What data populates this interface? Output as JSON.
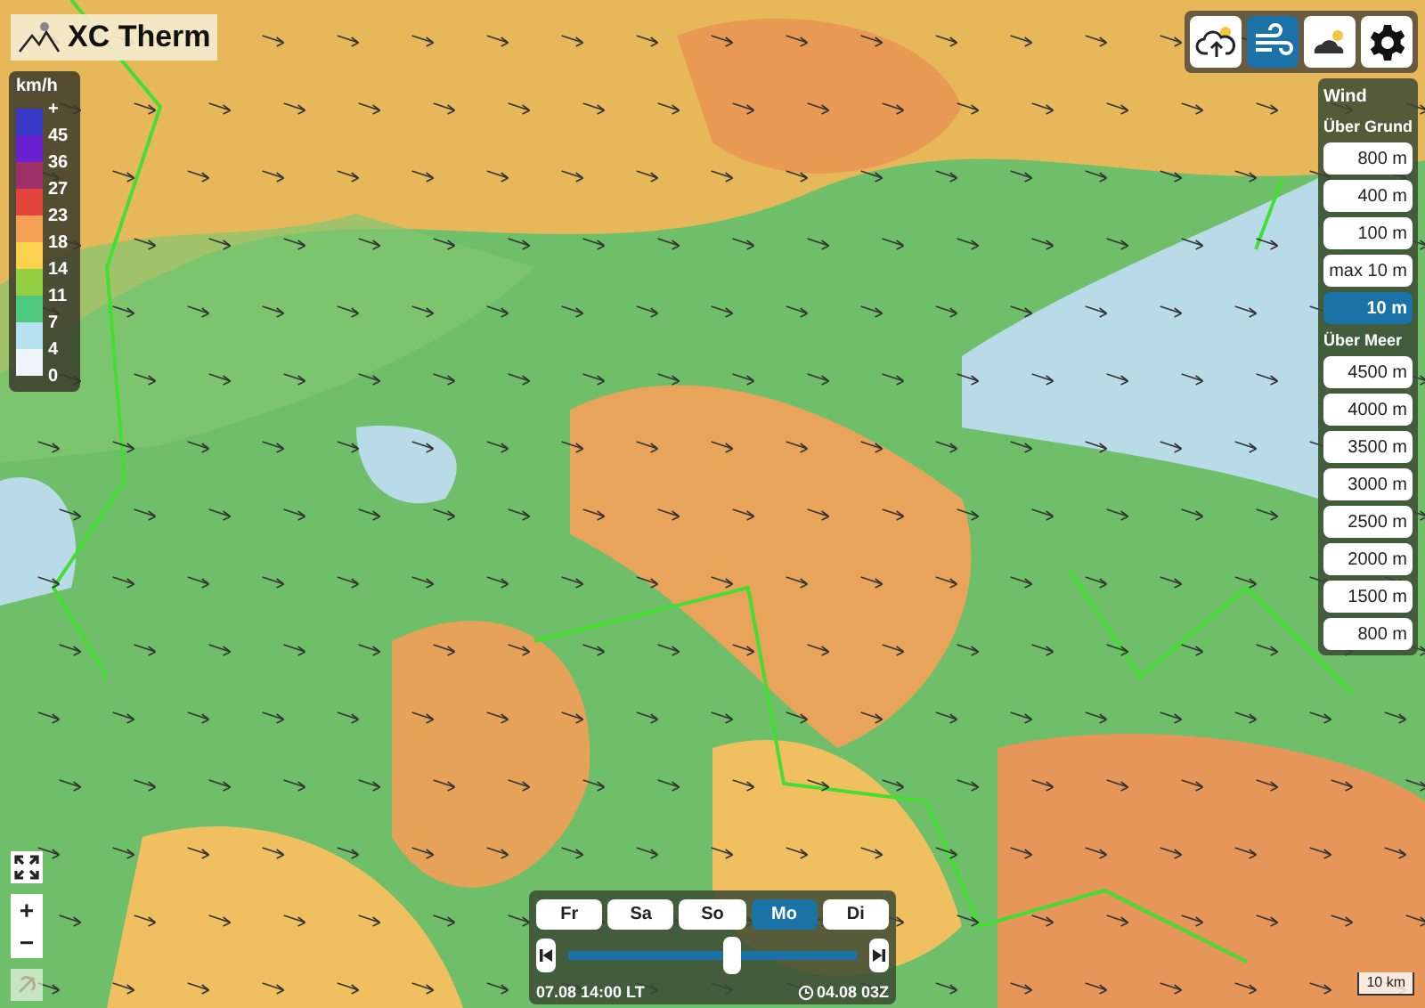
{
  "logo": {
    "title": "XC Therm"
  },
  "legend": {
    "unit": "km/h",
    "colors": [
      {
        "color": "#3a3ac8"
      },
      {
        "color": "#6a1fd0"
      },
      {
        "color": "#a0306a"
      },
      {
        "color": "#e2443c"
      },
      {
        "color": "#f5a055"
      },
      {
        "color": "#fbd24e"
      },
      {
        "color": "#93d044"
      },
      {
        "color": "#4ec87c"
      },
      {
        "color": "#b4e2f2"
      },
      {
        "color": "#eef4fa"
      }
    ],
    "labels": [
      "+",
      "45",
      "36",
      "27",
      "23",
      "18",
      "14",
      "11",
      "7",
      "4",
      "0"
    ]
  },
  "toolbar": [
    {
      "kind": "thermal",
      "selected": false
    },
    {
      "kind": "wind",
      "selected": true
    },
    {
      "kind": "clouds",
      "selected": false
    },
    {
      "kind": "settings",
      "selected": false
    }
  ],
  "wind_panel": {
    "title": "Wind",
    "sections": [
      {
        "heading": "Über Grund",
        "options": [
          {
            "label": "800 m",
            "selected": false
          },
          {
            "label": "400 m",
            "selected": false
          },
          {
            "label": "100 m",
            "selected": false
          },
          {
            "label": "max 10 m",
            "selected": false
          },
          {
            "label": "10 m",
            "selected": true
          }
        ]
      },
      {
        "heading": "Über Meer",
        "options": [
          {
            "label": "4500 m",
            "selected": false
          },
          {
            "label": "4000 m",
            "selected": false
          },
          {
            "label": "3500 m",
            "selected": false
          },
          {
            "label": "3000 m",
            "selected": false
          },
          {
            "label": "2500 m",
            "selected": false
          },
          {
            "label": "2000 m",
            "selected": false
          },
          {
            "label": "1500 m",
            "selected": false
          },
          {
            "label": "800 m",
            "selected": false
          }
        ]
      }
    ]
  },
  "map_controls": [
    {
      "kind": "fullscreen",
      "disabled": false
    },
    {
      "kind": "zoom_in",
      "label": "+",
      "disabled": false
    },
    {
      "kind": "zoom_out",
      "label": "−",
      "disabled": false
    },
    {
      "kind": "locate",
      "disabled": true
    }
  ],
  "timeline": {
    "days": [
      {
        "label": "Fr",
        "selected": false
      },
      {
        "label": "Sa",
        "selected": false
      },
      {
        "label": "So",
        "selected": false
      },
      {
        "label": "Mo",
        "selected": true
      },
      {
        "label": "Di",
        "selected": false
      }
    ],
    "level": 0.57,
    "local_time": "07.08 14:00 LT",
    "run_time": "04.08 03Z"
  },
  "scale": "10 km"
}
